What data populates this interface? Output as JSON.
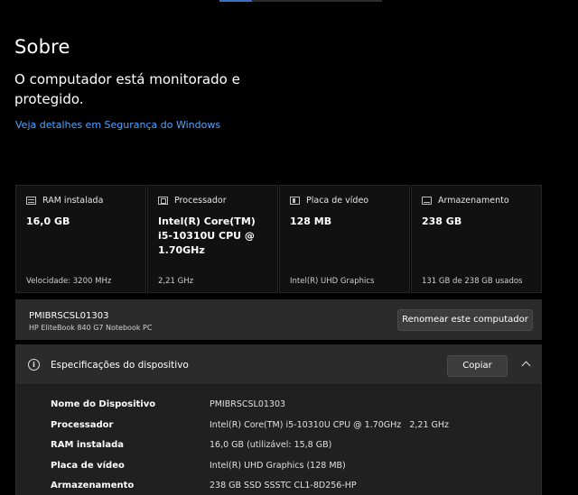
{
  "page": {
    "title": "Sobre",
    "status": "O computador está monitorado e protegido.",
    "security_link": "Veja detalhes em Segurança do Windows"
  },
  "cards": [
    {
      "icon": "ram-icon",
      "label": "RAM instalada",
      "value": "16,0 GB",
      "footer": "Velocidade: 3200 MHz"
    },
    {
      "icon": "processor-icon",
      "label": "Processador",
      "value": "Intel(R) Core(TM) i5-10310U CPU @ 1.70GHz",
      "footer": "2,21 GHz"
    },
    {
      "icon": "gpu-icon",
      "label": "Placa de vídeo",
      "value": "128 MB",
      "footer": "Intel(R) UHD Graphics"
    },
    {
      "icon": "storage-icon",
      "label": "Armazenamento",
      "value": "238 GB",
      "footer": "131 GB de 238 GB usados"
    }
  ],
  "device": {
    "name": "PMIBRSCSL01303",
    "model": "HP EliteBook 840 G7 Notebook PC",
    "rename_label": "Renomear este computador"
  },
  "specs": {
    "title": "Especificações do dispositivo",
    "copy_label": "Copiar",
    "rows": [
      {
        "key": "Nome do Dispositivo",
        "value": "PMIBRSCSL01303"
      },
      {
        "key": "Processador",
        "value": "Intel(R) Core(TM) i5-10310U CPU @ 1.70GHz   2,21 GHz"
      },
      {
        "key": "RAM instalada",
        "value": "16,0 GB (utilizável: 15,8 GB)"
      },
      {
        "key": "Placa de vídeo",
        "value": "Intel(R) UHD Graphics (128 MB)"
      },
      {
        "key": "Armazenamento",
        "value": "238 GB SSD SSSTC CL1-8D256-HP"
      }
    ]
  },
  "colors": {
    "background": "#000000",
    "card": "#111111",
    "panel": "#2b2b2b",
    "link": "#4ea5ff"
  }
}
